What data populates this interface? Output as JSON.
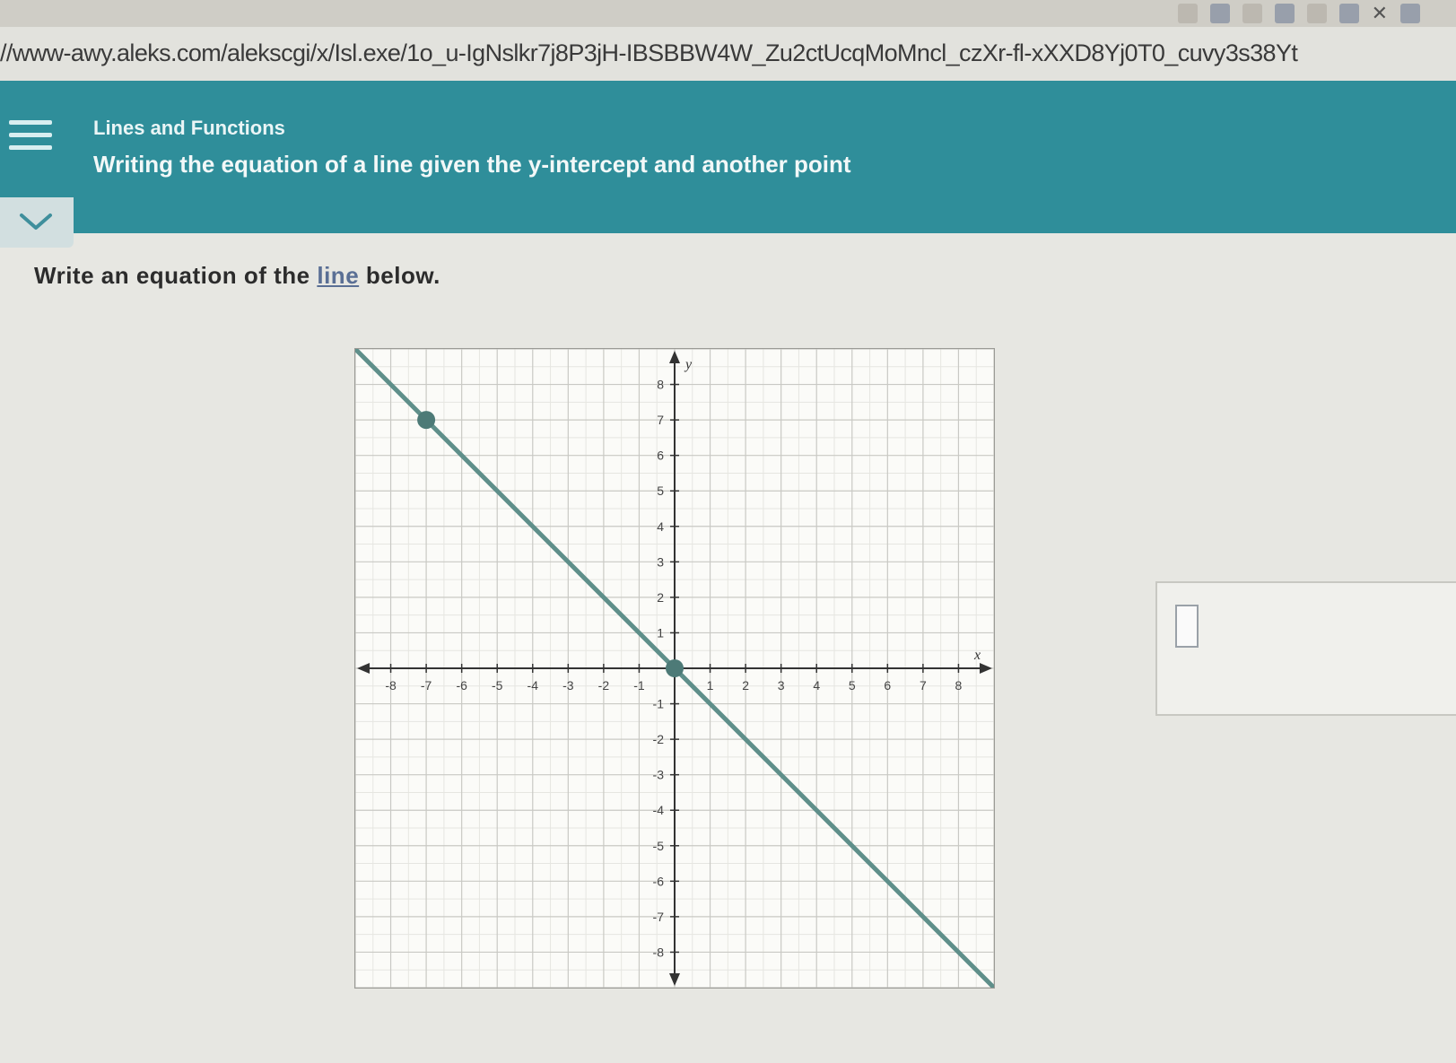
{
  "browser": {
    "url": "//www-awy.aleks.com/alekscgi/x/Isl.exe/1o_u-IgNslkr7j8P3jH-IBSBBW4W_Zu2ctUcqMoMncl_czXr-fl-xXXD8Yj0T0_cuvy3s38Yt"
  },
  "header": {
    "topic": "Lines and Functions",
    "subtitle": "Writing the equation of a line given the y-intercept and another point"
  },
  "question": {
    "prefix": "Write an equation of the ",
    "link": "line",
    "suffix": " below."
  },
  "chart_data": {
    "type": "line",
    "xlabel": "x",
    "ylabel": "y",
    "xlim": [
      -9,
      9
    ],
    "ylim": [
      -9,
      9
    ],
    "grid": true,
    "x_ticks": [
      -8,
      -7,
      -6,
      -5,
      -4,
      -3,
      -2,
      -1,
      1,
      2,
      3,
      4,
      5,
      6,
      7,
      8
    ],
    "y_ticks": [
      8,
      7,
      6,
      5,
      4,
      3,
      2,
      1,
      -1,
      -2,
      -3,
      -4,
      -5,
      -6,
      -7,
      -8
    ],
    "points": [
      {
        "x": -7,
        "y": 7
      },
      {
        "x": 0,
        "y": 0
      }
    ],
    "line": {
      "slope": -1,
      "intercept": 0
    },
    "colors": {
      "line": "#5f8f8a",
      "point": "#4d7a77"
    }
  },
  "answer": {
    "value": ""
  }
}
